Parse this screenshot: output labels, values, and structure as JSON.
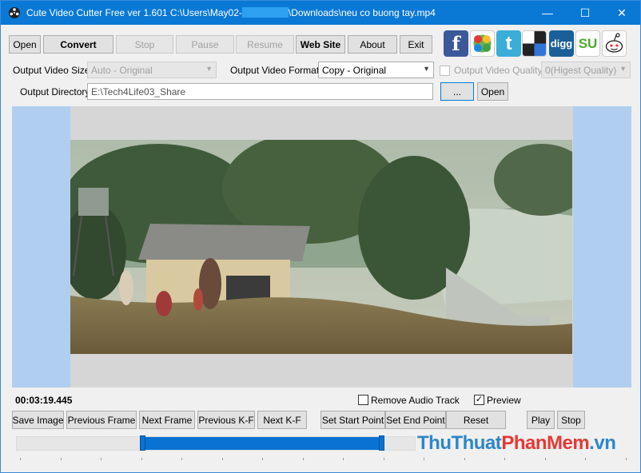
{
  "window": {
    "title_prefix": "Cute Video Cutter Free ver 1.601  C:\\Users\\May02-",
    "title_suffix": "\\Downloads\\neu co buong tay.mp4",
    "minimize": "—",
    "maximize": "☐",
    "close": "✕"
  },
  "toolbar": {
    "open": "Open",
    "convert": "Convert",
    "stop": "Stop",
    "pause": "Pause",
    "resume": "Resume",
    "website": "Web Site",
    "about": "About",
    "exit": "Exit"
  },
  "social": [
    {
      "icon": "facebook-icon",
      "glyph": "f",
      "color": "#3b5998"
    },
    {
      "icon": "google-icon",
      "glyph": "g",
      "color": "#4caf50"
    },
    {
      "icon": "twitter-icon",
      "glyph": "t",
      "color": "#3aaed8"
    },
    {
      "icon": "delicious-icon",
      "glyph": "",
      "color": "#222222"
    },
    {
      "icon": "digg-icon",
      "glyph": "digg",
      "color": "#1a5f97"
    },
    {
      "icon": "stumbleupon-icon",
      "glyph": "SU",
      "color": "#4ea830"
    },
    {
      "icon": "reddit-icon",
      "glyph": "☺",
      "color": "#ffffff"
    }
  ],
  "output": {
    "video_size_label": "Output Video Size:",
    "video_size_value": "Auto - Original",
    "video_format_label": "Output Video Format:",
    "video_format_value": "Copy - Original",
    "video_quality_label": "Output Video Quality",
    "video_quality_value": "0(Higest Quality)",
    "directory_label": "Output Directory:",
    "directory_value": "E:\\Tech4Life03_Share",
    "browse_button": "...",
    "open_button": "Open"
  },
  "playback": {
    "current_time": "00:03:19.445",
    "remove_audio_label": "Remove Audio Track",
    "remove_audio_checked": false,
    "preview_label": "Preview",
    "preview_checked": true
  },
  "controls": {
    "save_image": "Save Image",
    "previous_frame": "Previous Frame",
    "next_frame": "Next Frame",
    "previous_kf": "Previous K-F",
    "next_kf": "Next K-F",
    "set_start_point": "Set  Start Point",
    "set_end_point": "Set  End Point",
    "reset": "Reset",
    "play": "Play",
    "stop": "Stop"
  },
  "timeline": {
    "selection_start_fraction": 0.316,
    "selection_end_fraction": 0.916
  },
  "watermark": {
    "part1": "ThuThuat",
    "part2": "PhanMem",
    "part3": ".vn",
    "color1": "#2e86c8",
    "color2": "#e53935",
    "color3": "#2e86c8"
  },
  "colors": {
    "titlebar": "#0a79d6",
    "accent": "#0a72d2",
    "video_background": "#b0cff0"
  }
}
